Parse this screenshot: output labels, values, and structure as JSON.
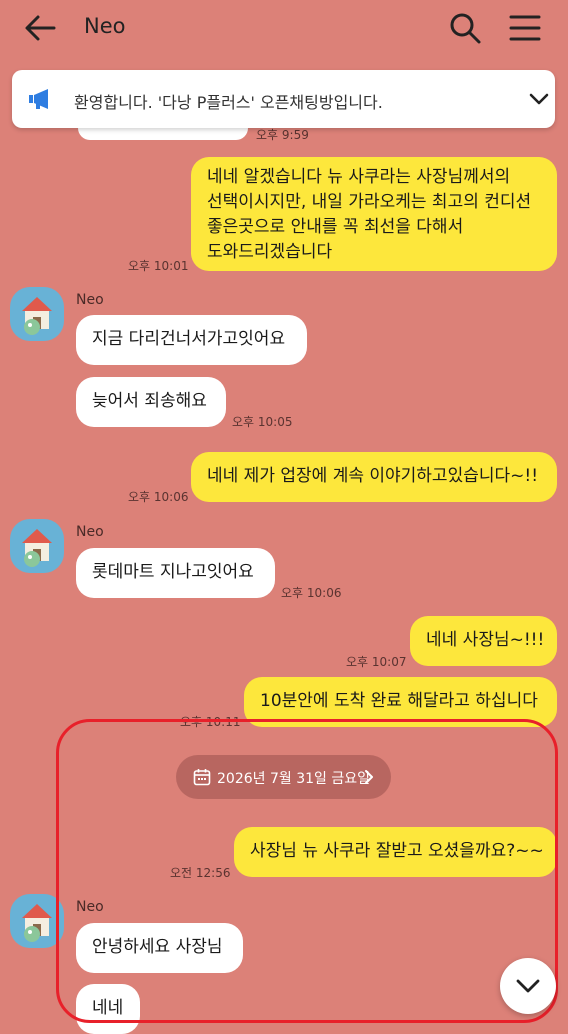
{
  "header": {
    "title": "Neo"
  },
  "notice": {
    "text": "환영합니다. '다낭 P플러스' 오픈채팅방입니다."
  },
  "messages": {
    "m0_time": "오후 9:59",
    "m1_text": [
      "네네 알겠습니다 뉴 사쿠라는 사장님께서의",
      "선택이시지만, 내일 가라오케는 최고의 컨디션",
      "좋은곳으로 안내를 꼭 최선을 다해서",
      "도와드리겠습니다"
    ],
    "m1_time": "오후 10:01",
    "sender1": "Neo",
    "m2_text": "지금 다리건너서가고잇어요",
    "m3_text": "늦어서 죄송해요",
    "m3_time": "오후 10:05",
    "m4_text": "네네 제가 업장에 계속 이야기하고있습니다~!!",
    "m4_time": "오후 10:06",
    "sender2": "Neo",
    "m5_text": "롯데마트 지나고잇어요",
    "m5_time": "오후 10:06",
    "m6_text": "네네 사장님~!!!",
    "m6_time": "오후 10:07",
    "m7_text": "10분안에 도착 완료 해달라고 하십니다",
    "m7_time": "오후 10:11",
    "date_divider": "2026년 7월 31일 금요일",
    "m8_text": "사장님 뉴 사쿠라 잘받고 오셨을까요?~~",
    "m8_time": "오전 12:56",
    "sender3": "Neo",
    "m9_text": "안녕하세요 사장님",
    "m10_text": "네네"
  },
  "colors": {
    "background": "#dc8178",
    "my_bubble": "#fde73c",
    "other_bubble": "#ffffff",
    "highlight": "#e8202a"
  },
  "icons": [
    "back-arrow-icon",
    "search-icon",
    "menu-icon",
    "megaphone-icon",
    "chevron-down-icon",
    "calendar-icon",
    "chevron-right-icon",
    "avatar-house-icon"
  ]
}
